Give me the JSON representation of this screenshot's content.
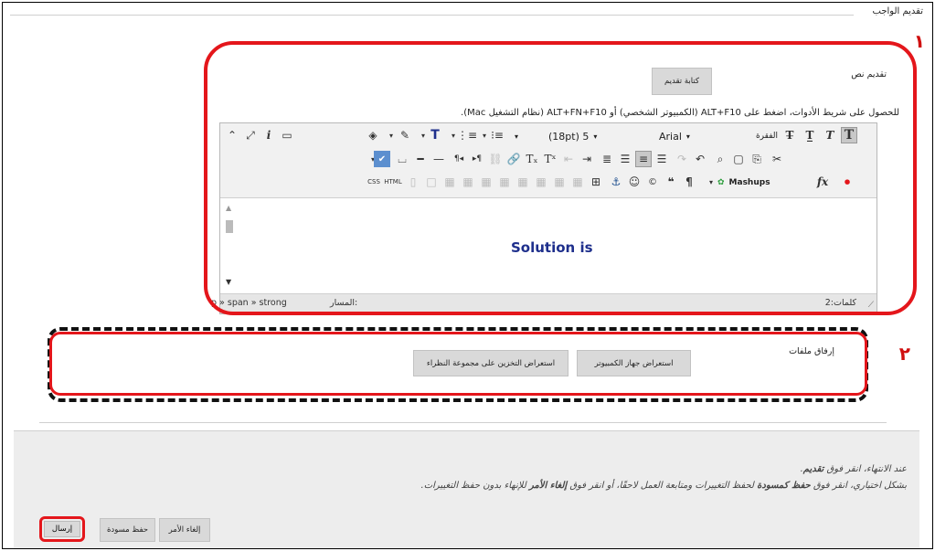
{
  "section": {
    "title": "تقديم الواجب"
  },
  "annotations": {
    "one": "١",
    "two": "٢"
  },
  "text_submission": {
    "label": "تقديم نص",
    "write_button": "كتابة تقديم",
    "hint": "للحصول على شريط الأدوات، اضغط على ALT+F10 (الكمبيوتر الشخصي) أو ALT+FN+F10 (نظام التشغيل Mac)."
  },
  "editor": {
    "paragraph_select": "الفقرة",
    "font_select": "Arial",
    "size_select": "(18pt) 5",
    "mashups_label": "Mashups",
    "content": "Solution is",
    "path_label": "المسار:",
    "path_value": "p » span » strong",
    "words_label": "كلمات:",
    "words_count": "2"
  },
  "attach": {
    "label": "إرفاق ملفات",
    "browse_computer": "استعراض جهاز الكمبيوتر",
    "browse_cloud": "استعراض التخزين على مجموعة النظراء"
  },
  "footer": {
    "instruction_prefix": "عند الانتهاء، انقر فوق ",
    "instruction_bold": "تقديم",
    "instruction_suffix": ".",
    "optional_a": "بشكل اختياري، انقر فوق ",
    "optional_b": "حفظ كمسودة",
    "optional_c": " لحفظ التغييرات ومتابعة العمل لاحقًا، أو انقر فوق ",
    "optional_d": "إلغاء الأمر",
    "optional_e": " للإنهاء بدون حفظ التغييرات."
  },
  "actions": {
    "cancel": "إلغاء الأمر",
    "save_draft": "حفظ مسودة",
    "submit": "إرسال"
  }
}
